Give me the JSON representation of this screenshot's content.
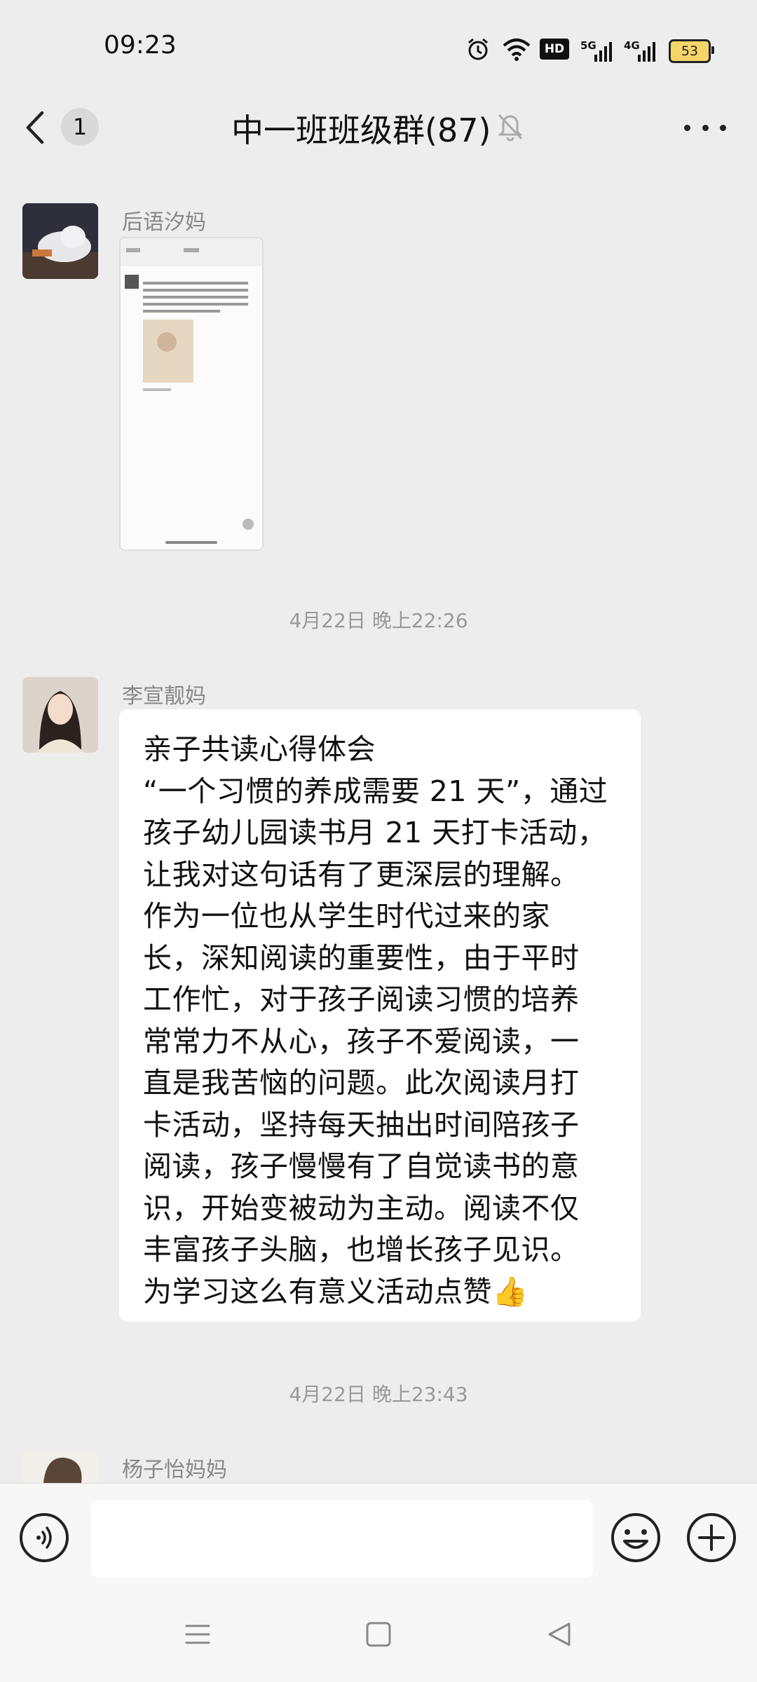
{
  "status_bar": {
    "time": "09:23",
    "icons": [
      "alarm-icon",
      "wifi-icon",
      "hd-icon",
      "signal-5g-icon",
      "signal-4g-icon",
      "battery-icon"
    ],
    "hd_label": "HD",
    "net1_label": "5G",
    "net2_label": "4G",
    "battery_level": "53"
  },
  "header": {
    "unread_count": "1",
    "title": "中一班班级群(87)",
    "icons": [
      "back-icon",
      "mute-bell-icon",
      "more-icon"
    ]
  },
  "messages": [
    {
      "sender": "后语汐妈",
      "type": "image"
    },
    {
      "timestamp": "4月22日 晚上22:26"
    },
    {
      "sender": "李宣靓妈",
      "type": "text",
      "text": "亲子共读心得体会\n“一个习惯的养成需要 21 天”，通过\n孩子幼儿园读书月 21 天打卡活动，\n让我对这句话有了更深层的理解。\n作为一位也从学生时代过来的家\n长，深知阅读的重要性，由于平时\n工作忙，对于孩子阅读习惯的培养\n常常力不从心，孩子不爱阅读，一\n直是我苦恼的问题。此次阅读月打\n卡活动，坚持每天抽出时间陪孩子\n阅读，孩子慢慢有了自觉读书的意\n识，开始变被动为主动。阅读不仅\n丰富孩子头脑，也增长孩子见识。\n为学习这么有意义活动点赞👍"
    },
    {
      "timestamp": "4月22日 晚上23:43"
    },
    {
      "sender": "杨子怡妈妈"
    }
  ],
  "input_bar": {
    "placeholder": "",
    "icons": [
      "voice-icon",
      "emoji-icon",
      "plus-icon"
    ]
  },
  "nav_bar": {
    "icons": [
      "menu-icon",
      "home-icon",
      "back-triangle-icon"
    ]
  }
}
